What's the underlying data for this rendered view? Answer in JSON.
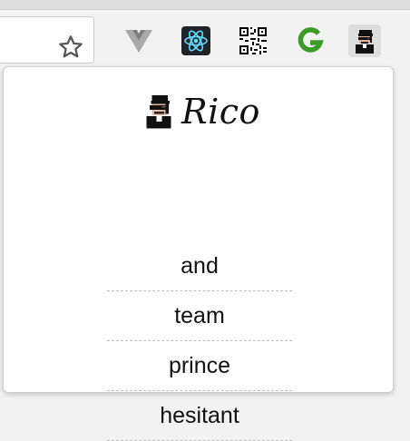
{
  "browser": {
    "extensions": [
      {
        "name": "vue-devtools-icon"
      },
      {
        "name": "react-devtools-icon"
      },
      {
        "name": "qr-code-icon"
      },
      {
        "name": "grammarly-g-icon"
      },
      {
        "name": "rico-avatar-icon"
      }
    ]
  },
  "popup": {
    "title": "Rico",
    "words": [
      "and",
      "team",
      "prince",
      "hesitant"
    ]
  },
  "colors": {
    "react": "#61dafb",
    "react_bg": "#20232a",
    "green_g": "#3b9b27",
    "vue_gray": "#9e9e9e"
  }
}
